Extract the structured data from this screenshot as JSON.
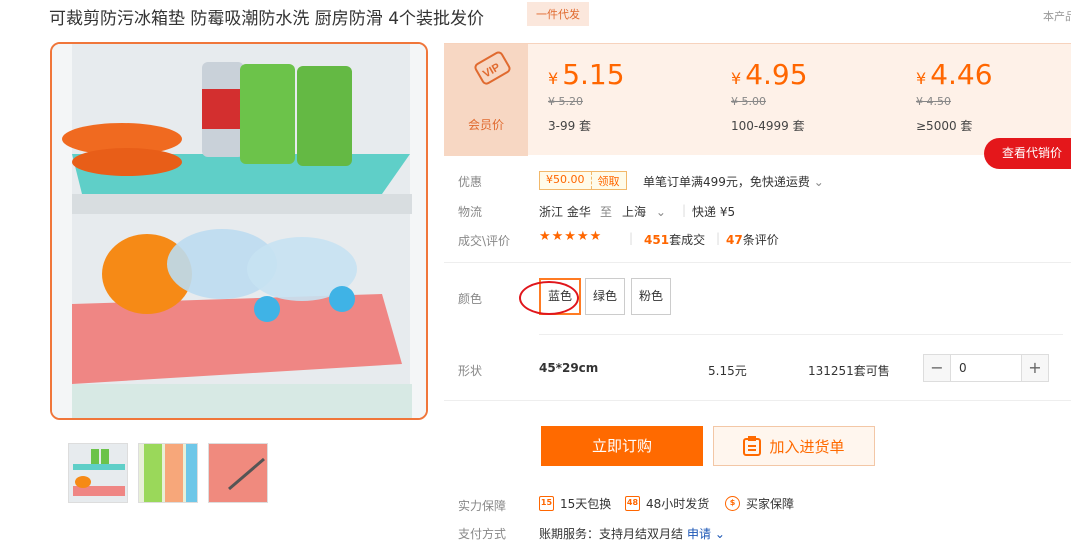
{
  "title": "可裁剪防污冰箱垫 防霉吸潮防水洗 厨房防滑 4个装批发价",
  "badge": "一件代发",
  "top_right": "本产品",
  "vip": {
    "label": "会员价"
  },
  "price_tiers": [
    {
      "currency": "¥",
      "price": "5.15",
      "old": "¥ 5.20",
      "qty": "3-99 套"
    },
    {
      "currency": "¥",
      "price": "4.95",
      "old": "¥ 5.00",
      "qty": "100-4999 套"
    },
    {
      "currency": "¥",
      "price": "4.46",
      "old": "¥ 4.50",
      "qty": "≥5000 套"
    }
  ],
  "agent_button": "查看代销价",
  "promo": {
    "label": "优惠",
    "coupon_amount": "¥50.00",
    "coupon_get": "领取",
    "text": "单笔订单满499元，免快递运费"
  },
  "logistics": {
    "label": "物流",
    "from": "浙江 金华",
    "to_word": "至",
    "to": "上海",
    "express": "快递 ¥5"
  },
  "deals": {
    "label": "成交\\评价",
    "stars": "★★★★★",
    "sold_count": "451",
    "sold_text": "套成交",
    "review_count": "47",
    "review_text": "条评价"
  },
  "colors": {
    "label": "颜色",
    "options": [
      "蓝色",
      "绿色",
      "粉色"
    ],
    "selected": "蓝色"
  },
  "shape": {
    "label": "形状",
    "size": "45*29cm",
    "price": "5.15元",
    "stock": "131251套可售",
    "quantity": "0"
  },
  "actions": {
    "buy": "立即订购",
    "cart": "加入进货单"
  },
  "guarantee": {
    "label": "实力保障",
    "items": [
      {
        "icon": "15",
        "text": "15天包换"
      },
      {
        "icon": "48",
        "text": "48小时发货"
      },
      {
        "icon": "$",
        "text": "买家保障"
      }
    ]
  },
  "payment": {
    "label": "支付方式",
    "text": "账期服务：支持月结双月结",
    "link": "申请"
  },
  "colors_hex": {
    "accent": "#ff6600",
    "red": "#e4171b",
    "panel": "#fef1e8"
  }
}
